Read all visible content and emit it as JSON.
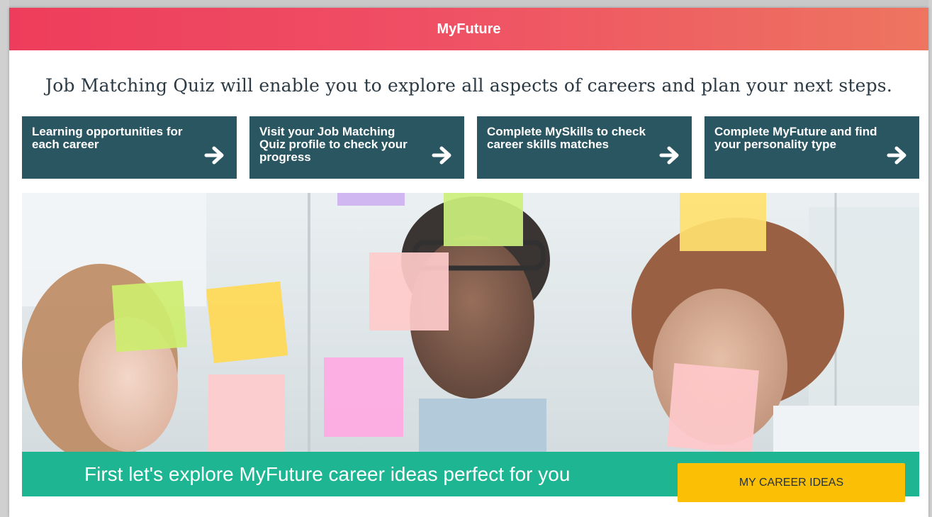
{
  "modal": {
    "title": "MyFuture"
  },
  "headline": "Job Matching Quiz will enable you to explore all aspects of careers and plan your next steps.",
  "cards": [
    {
      "label": "Learning opportunities for each career",
      "icon": "arrow-right-icon"
    },
    {
      "label": "Visit your Job Matching Quiz profile to check your progress",
      "icon": "arrow-right-icon"
    },
    {
      "label": "Complete MySkills to check career skills matches",
      "icon": "arrow-right-icon"
    },
    {
      "label": "Complete MyFuture and find your personality type",
      "icon": "arrow-right-icon"
    }
  ],
  "cta": {
    "text": "First let's explore MyFuture career ideas perfect for you",
    "button_label": "MY CAREER IDEAS"
  },
  "colors": {
    "header_gradient_start": "#ee3d5c",
    "header_gradient_end": "#ee7560",
    "card_bg": "#2a5661",
    "cta_bar_bg": "#1db592",
    "cta_button_bg": "#fbbf06",
    "headline_text": "#2b3a44"
  }
}
